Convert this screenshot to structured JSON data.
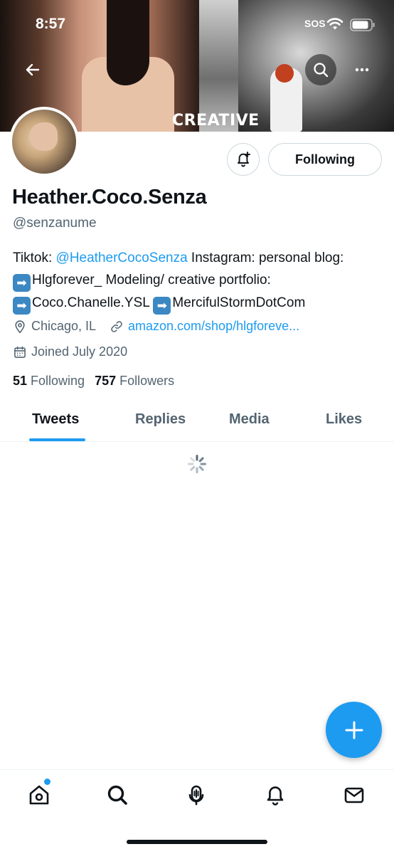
{
  "status_bar": {
    "time": "8:57",
    "sos": "SOS"
  },
  "banner": {
    "caption": "CREATIVE"
  },
  "profile": {
    "display_name": "Heather.Coco.Senza",
    "handle": "@senzanume",
    "bio": {
      "prefix": "Tiktok: ",
      "tiktok_link": "@HeatherCocoSenza",
      "line1_rest": " Instagram: personal blog:",
      "line2": "Hlgforever_ Modeling/ creative portfolio:",
      "line3a": "Coco.Chanelle.YSL",
      "line3b": "MercifulStormDotCom",
      "arrow": "➡"
    },
    "location": "Chicago, IL",
    "website": "amazon.com/shop/hlgforeve...",
    "joined": "Joined July 2020",
    "following_count": "51",
    "following_label": "Following",
    "followers_count": "757",
    "followers_label": "Followers"
  },
  "actions": {
    "following_button": "Following"
  },
  "tabs": [
    {
      "label": "Tweets",
      "active": true
    },
    {
      "label": "Replies",
      "active": false
    },
    {
      "label": "Media",
      "active": false
    },
    {
      "label": "Likes",
      "active": false
    }
  ],
  "colors": {
    "accent": "#1d9bf0",
    "secondary_text": "#536471",
    "primary_text": "#0f1419"
  },
  "icons": {
    "back": "back-arrow-icon",
    "search": "search-icon",
    "more": "more-icon",
    "notify": "bell-plus-icon",
    "location": "location-pin-icon",
    "link": "link-icon",
    "calendar": "calendar-icon",
    "compose": "plus-icon",
    "nav": [
      "home-icon",
      "search-icon",
      "spaces-icon",
      "notifications-icon",
      "messages-icon"
    ]
  }
}
